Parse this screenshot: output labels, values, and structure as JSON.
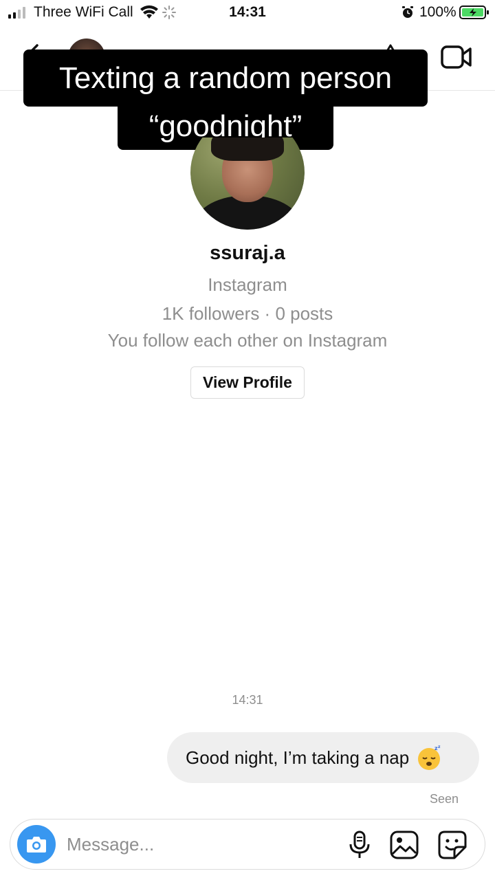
{
  "status_bar": {
    "carrier": "Three WiFi Call",
    "time": "14:31",
    "battery_percent": "100%",
    "icons": [
      "signal-icon",
      "wifi-icon",
      "activity-spinner-icon",
      "alarm-icon",
      "battery-charging-icon"
    ]
  },
  "header": {
    "icons": [
      "back-arrow-icon",
      "info-icon",
      "video-call-icon"
    ]
  },
  "caption": {
    "line1": "Texting a random person",
    "line2": "“goodnight”"
  },
  "profile": {
    "username": "ssuraj.a",
    "platform": "Instagram",
    "stats": "1K followers · 0 posts",
    "mutual": "You follow each other on Instagram",
    "view_profile_label": "View Profile"
  },
  "conversation": {
    "timestamp": "14:31",
    "message": "Good night, I’m taking a nap",
    "message_emoji": "sleeping-face-emoji",
    "seen_label": "Seen"
  },
  "composer": {
    "placeholder": "Message...",
    "icons": [
      "camera-icon",
      "microphone-icon",
      "gallery-icon",
      "sticker-icon"
    ]
  },
  "colors": {
    "accent": "#3897f0",
    "bubble": "#efefef",
    "secondary_text": "#8e8e8e",
    "battery": "#4cd964"
  }
}
